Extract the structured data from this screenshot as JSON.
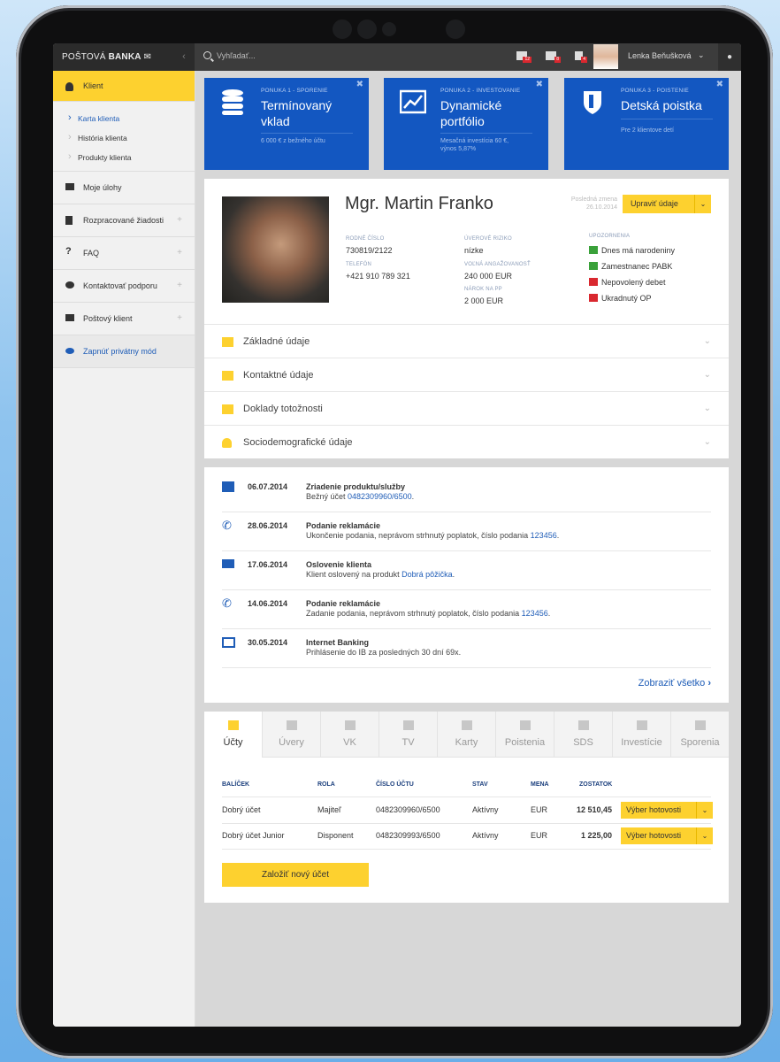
{
  "topbar": {
    "logo_prefix": "POŠTOVÁ",
    "logo_brand": "BANKA",
    "search_placeholder": "Vyhľadať...",
    "badges": [
      "12",
      "8",
      "4"
    ],
    "user_name": "Lenka Beňušková"
  },
  "sidebar": {
    "client": "Klient",
    "sub": [
      "Karta klienta",
      "História klienta",
      "Produkty klienta"
    ],
    "items": [
      "Moje úlohy",
      "Rozpracované žiadosti",
      "FAQ",
      "Kontaktovať podporu",
      "Poštový klient"
    ],
    "private_mode": "Zapnúť privátny mód"
  },
  "offers": [
    {
      "label": "PONUKA 1 - SPORENIE",
      "title_1": "Termínovaný",
      "title_2": "vklad",
      "desc_1": "6 000 € z bežného účtu",
      "desc_2": ""
    },
    {
      "label": "PONUKA 2 - INVESTOVANIE",
      "title_1": "Dynamické",
      "title_2": "portfólio",
      "desc_1": "Mesačná investícia 60 €,",
      "desc_2": "výnos 5,87%"
    },
    {
      "label": "PONUKA 3 - POISTENIE",
      "title_1": "Detská poistka",
      "title_2": "",
      "desc_1": "Pre 2 klientove detí",
      "desc_2": ""
    }
  ],
  "profile": {
    "name": "Mgr. Martin Franko",
    "last_change_label": "Posledná zmena",
    "last_change_date": "26.10.2014",
    "edit_button": "Upraviť údaje",
    "birth_number_label": "RODNÉ ČÍSLO",
    "birth_number": "730819/2122",
    "phone_label": "TELEFÓN",
    "phone": "+421 910 789 321",
    "credit_risk_label": "ÚVEROVÉ RIZIKO",
    "credit_risk": "nízke",
    "free_commitment_label": "VOĽNÁ ANGAŽOVANOSŤ",
    "free_commitment": "240 000 EUR",
    "pp_claim_label": "NÁROK NA PP",
    "pp_claim": "2 000 EUR",
    "warnings_label": "UPOZORNENIA",
    "warnings": [
      "Dnes má narodeniny",
      "Zamestnanec PABK",
      "Nepovolený debet",
      "Ukradnutý OP"
    ],
    "warning_colors": [
      "#3aa13a",
      "#3aa13a",
      "#d9282f",
      "#d9282f"
    ]
  },
  "accordions": [
    "Základné údaje",
    "Kontaktné údaje",
    "Doklady totožnosti",
    "Sociodemografické údaje"
  ],
  "timeline": [
    {
      "icon": "bank-icon",
      "date": "06.07.2014",
      "title": "Zriadenie produktu/služby",
      "desc": "Bežný účet ",
      "link": "0482309960/6500",
      "after": "."
    },
    {
      "icon": "phone-icon",
      "date": "28.06.2014",
      "title": "Podanie reklamácie",
      "desc": "Ukončenie podania, neprávom strhnutý poplatok, číslo podania ",
      "link": "123456",
      "after": "."
    },
    {
      "icon": "envelope-icon",
      "date": "17.06.2014",
      "title": "Oslovenie klienta",
      "desc": "Klient oslovený na produkt ",
      "link": "Dobrá pôžička",
      "after": "."
    },
    {
      "icon": "phone-icon",
      "date": "14.06.2014",
      "title": "Podanie reklamácie",
      "desc": "Zadanie podania, neprávom strhnutý poplatok, číslo podania ",
      "link": "123456",
      "after": "."
    },
    {
      "icon": "monitor-icon",
      "date": "30.05.2014",
      "title": "Internet Banking",
      "desc": "Prihlásenie do IB za posledných 30 dní 69x.",
      "link": "",
      "after": ""
    }
  ],
  "show_all": "Zobraziť všetko",
  "tabs": [
    "Účty",
    "Úvery",
    "VK",
    "TV",
    "Karty",
    "Poistenia",
    "SDS",
    "Investície",
    "Sporenia"
  ],
  "accounts": {
    "headers": [
      "BALÍČEK",
      "ROLA",
      "ČÍSLO ÚČTU",
      "STAV",
      "MENA",
      "ZOSTATOK"
    ],
    "rows": [
      {
        "package": "Dobrý účet",
        "role": "Majiteľ",
        "account": "0482309960/6500",
        "state": "Aktívny",
        "currency": "EUR",
        "balance": "12 510,45",
        "action": "Výber hotovosti"
      },
      {
        "package": "Dobrý účet Junior",
        "role": "Disponent",
        "account": "0482309993/6500",
        "state": "Aktívny",
        "currency": "EUR",
        "balance": "1 225,00",
        "action": "Výber hotovosti"
      }
    ],
    "new_account": "Založiť nový účet"
  },
  "colors": {
    "accent": "#fdd12f",
    "brand_blue": "#1357c1",
    "link": "#1f5db7"
  }
}
